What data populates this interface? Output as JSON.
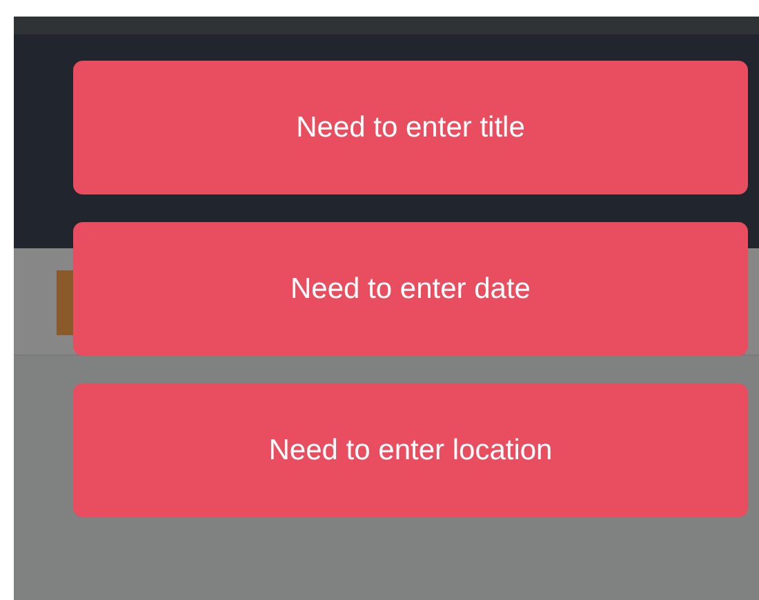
{
  "toasts": [
    {
      "message": "Need to enter title"
    },
    {
      "message": "Need to enter date"
    },
    {
      "message": "Need to enter location"
    }
  ]
}
